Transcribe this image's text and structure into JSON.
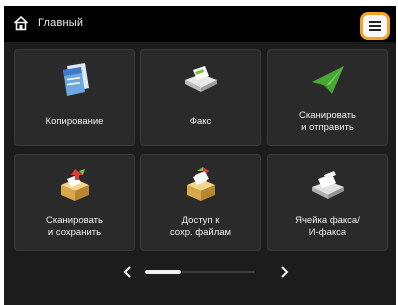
{
  "header": {
    "title": "Главный",
    "home_icon": "home-icon",
    "menu_icon": "hamburger-menu-icon",
    "menu_highlight_color": "#f4a423"
  },
  "tiles": [
    {
      "label": "Копирование",
      "icon": "copy-icon"
    },
    {
      "label": "Факс",
      "icon": "fax-icon"
    },
    {
      "label": "Сканировать\nи отправить",
      "icon": "scan-send-icon"
    },
    {
      "label": "Сканировать\nи сохранить",
      "icon": "scan-save-icon"
    },
    {
      "label": "Доступ к\nсохр. файлам",
      "icon": "stored-files-icon"
    },
    {
      "label": "Ячейка факса/\nИ-факса",
      "icon": "fax-inbox-icon"
    }
  ],
  "pager": {
    "prev_icon": "chevron-left-icon",
    "next_icon": "chevron-right-icon",
    "page_position": "1 of 3"
  }
}
